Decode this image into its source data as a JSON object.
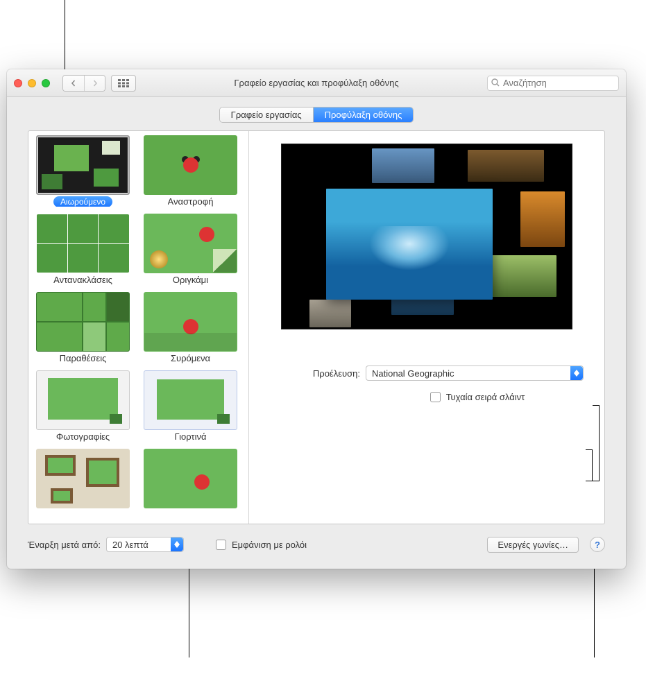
{
  "window": {
    "title": "Γραφείο εργασίας και προφύλαξη οθόνης",
    "search_placeholder": "Αναζήτηση"
  },
  "tabs": {
    "desktop": "Γραφείο εργασίας",
    "screensaver": "Προφύλαξη οθόνης"
  },
  "screensavers": [
    {
      "label": "Αιωρούμενο",
      "selected": true
    },
    {
      "label": "Αναστροφή"
    },
    {
      "label": "Αντανακλάσεις"
    },
    {
      "label": "Οριγκάμι"
    },
    {
      "label": "Παραθέσεις"
    },
    {
      "label": "Συρόμενα"
    },
    {
      "label": "Φωτογραφίες"
    },
    {
      "label": "Γιορτινά"
    }
  ],
  "detail": {
    "source_label": "Προέλευση:",
    "source_value": "National Geographic",
    "random_label": "Τυχαία σειρά σλάιντ"
  },
  "bottom": {
    "start_after_label": "Έναρξη μετά από:",
    "start_after_value": "20 λεπτά",
    "show_clock_label": "Εμφάνιση με ρολόι",
    "hot_corners": "Ενεργές γωνίες…"
  },
  "icons": {
    "help": "?"
  }
}
